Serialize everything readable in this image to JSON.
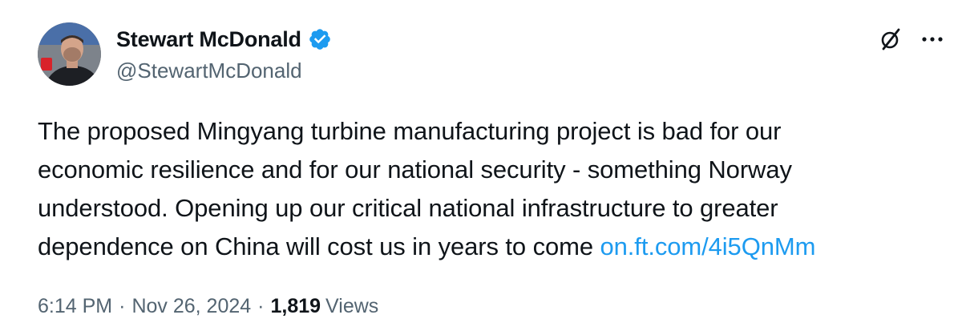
{
  "author": {
    "display_name": "Stewart McDonald",
    "handle": "@StewartMcDonald",
    "verified": true,
    "verified_color": "#1d9bf0"
  },
  "actions": {
    "grok_icon": "grok-slash-icon",
    "more_icon": "more-horizontal-icon"
  },
  "tweet": {
    "lines": [
      "The proposed Mingyang turbine manufacturing project is bad for our",
      "economic resilience and for our national security - something Norway",
      "understood. Opening up our critical national infrastructure to greater",
      "dependence on China will cost us in years to come "
    ],
    "link_text": "on.ft.com/4i5QnMm",
    "link_color": "#1d9bf0"
  },
  "meta": {
    "time": "6:14 PM",
    "separator": "·",
    "date": "Nov 26, 2024",
    "views_count": "1,819",
    "views_label": "Views"
  },
  "colors": {
    "text_primary": "#0f1419",
    "text_secondary": "#536471",
    "background": "#ffffff"
  }
}
